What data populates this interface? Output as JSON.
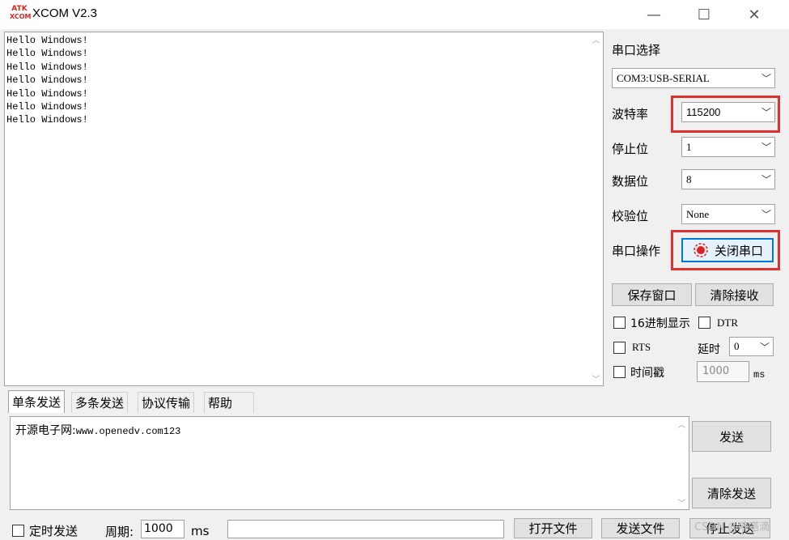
{
  "window": {
    "logo_top": "ATK",
    "logo_bottom": "XCOM",
    "title": "XCOM V2.3",
    "minimize": "—",
    "maximize": "☐",
    "close": "✕"
  },
  "receive": {
    "lines": "Hello Windows!\nHello Windows!\nHello Windows!\nHello Windows!\nHello Windows!\nHello Windows!\nHello Windows!"
  },
  "settings": {
    "port_label": "串口选择",
    "port_value": "COM3:USB-SERIAL",
    "baud_label": "波特率",
    "baud_value": "115200",
    "stop_label": "停止位",
    "stop_value": "1",
    "data_label": "数据位",
    "data_value": "8",
    "parity_label": "校验位",
    "parity_value": "None",
    "op_label": "串口操作",
    "op_button": "关闭串口",
    "save_window": "保存窗口",
    "clear_receive": "清除接收",
    "hex_display": "16进制显示",
    "dtr": "DTR",
    "rts": "RTS",
    "delay_label": "延时",
    "delay_value": "0",
    "timestamp": "时间戳",
    "timestamp_value": "1000",
    "timestamp_unit": "ms"
  },
  "tabs": [
    "单条发送",
    "多条发送",
    "协议传输",
    "帮助"
  ],
  "send": {
    "text_cn": "开源电子网:",
    "text_mono": "www.openedv.com123",
    "send_button": "发送",
    "clear_send": "清除发送"
  },
  "bottom": {
    "timed_send": "定时发送",
    "period_label": "周期:",
    "period_value": "1000",
    "period_unit": "ms",
    "open_file": "打开文件",
    "send_file": "发送文件",
    "stop_send": "停止发送",
    "watermark": "CSDN @嘀嗒滴"
  }
}
